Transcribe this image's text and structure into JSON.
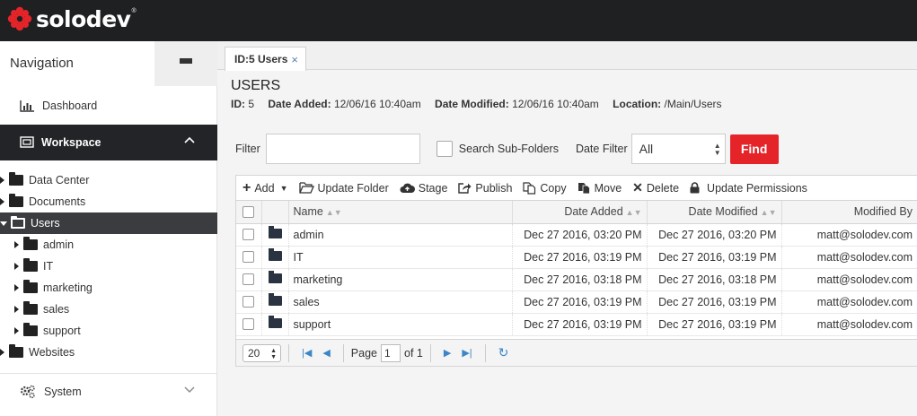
{
  "brand": {
    "name": "solodev",
    "reg": "®",
    "accent": "#e5242a"
  },
  "nav": {
    "title": "Navigation",
    "dashboard": "Dashboard",
    "workspace": "Workspace",
    "system": "System",
    "tree": [
      {
        "label": "Data Center",
        "level": 0,
        "open": false
      },
      {
        "label": "Documents",
        "level": 0,
        "open": false
      },
      {
        "label": "Users",
        "level": 0,
        "open": true,
        "selected": true
      },
      {
        "label": "admin",
        "level": 1,
        "open": false
      },
      {
        "label": "IT",
        "level": 1,
        "open": false
      },
      {
        "label": "marketing",
        "level": 1,
        "open": false
      },
      {
        "label": "sales",
        "level": 1,
        "open": false
      },
      {
        "label": "support",
        "level": 1,
        "open": false
      },
      {
        "label": "Websites",
        "level": 0,
        "open": false
      }
    ]
  },
  "tab": {
    "label": "ID:5 Users",
    "close": "×"
  },
  "page": {
    "title": "USERS",
    "id_label": "ID:",
    "id_value": "5",
    "added_label": "Date Added:",
    "added_value": "12/06/16 10:40am",
    "modified_label": "Date Modified:",
    "modified_value": "12/06/16 10:40am",
    "location_label": "Location:",
    "location_value": "/Main/Users"
  },
  "filter": {
    "label": "Filter",
    "value": "",
    "subfolders": "Search Sub-Folders",
    "date_label": "Date Filter",
    "date_value": "All",
    "find": "Find"
  },
  "toolbar": {
    "add": "Add",
    "update_folder": "Update Folder",
    "stage": "Stage",
    "publish": "Publish",
    "copy": "Copy",
    "move": "Move",
    "delete": "Delete",
    "update_permissions": "Update Permissions"
  },
  "table": {
    "columns": {
      "name": "Name",
      "added": "Date Added",
      "modified": "Date Modified",
      "by": "Modified By"
    },
    "rows": [
      {
        "name": "admin",
        "added": "Dec 27 2016, 03:20 PM",
        "modified": "Dec 27 2016, 03:20 PM",
        "by": "matt@solodev.com"
      },
      {
        "name": "IT",
        "added": "Dec 27 2016, 03:19 PM",
        "modified": "Dec 27 2016, 03:19 PM",
        "by": "matt@solodev.com"
      },
      {
        "name": "marketing",
        "added": "Dec 27 2016, 03:18 PM",
        "modified": "Dec 27 2016, 03:18 PM",
        "by": "matt@solodev.com"
      },
      {
        "name": "sales",
        "added": "Dec 27 2016, 03:19 PM",
        "modified": "Dec 27 2016, 03:19 PM",
        "by": "matt@solodev.com"
      },
      {
        "name": "support",
        "added": "Dec 27 2016, 03:19 PM",
        "modified": "Dec 27 2016, 03:19 PM",
        "by": "matt@solodev.com"
      }
    ]
  },
  "pager": {
    "size": "20",
    "page_label": "Page",
    "page": "1",
    "of": "of 1"
  }
}
